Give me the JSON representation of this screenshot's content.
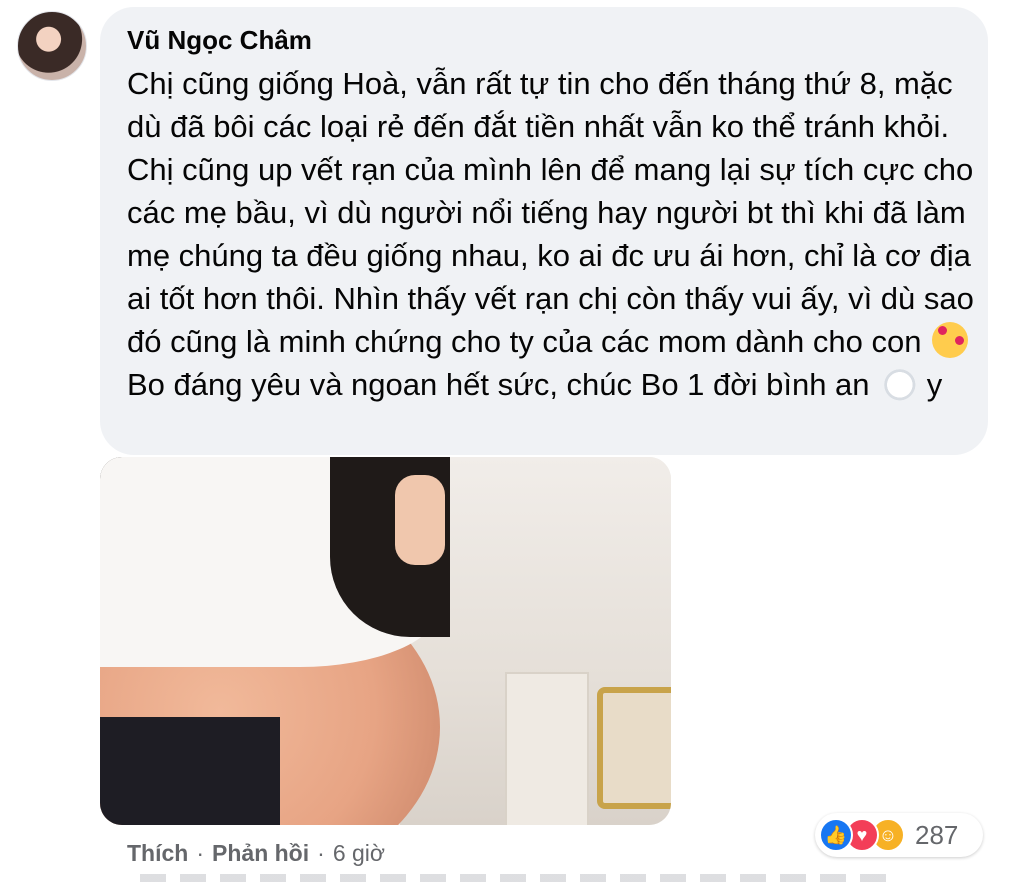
{
  "comment": {
    "author": "Vũ Ngọc Châm",
    "text_part1": "Chị cũng giống Hoà, vẫn rất tự tin cho đến tháng thứ 8, mặc dù đã bôi các loại rẻ đến đắt tiền nhất vẫn ko thể tránh khỏi. Chị cũng up vết rạn của mình lên để mang lại sự tích cực cho các mẹ bầu, vì dù người nổi tiếng hay người bt thì khi đã làm mẹ chúng ta đều giống nhau, ko ai đc ưu ái hơn, chỉ là cơ địa ai tốt hơn thôi. Nhìn thấy vết rạn chị còn thấy vui ấy, vì dù sao đó cũng là minh chứng cho ty của các mom dành cho con",
    "emoji1": "smiling-face-with-hearts",
    "text_part2": "Bo đáng yêu và ngoan hết sức, chúc Bo 1 đời bình an",
    "emoji2": "dove",
    "text_part3": "y"
  },
  "actions": {
    "like": "Thích",
    "reply": "Phản hồi",
    "separator": "·",
    "time": "6 giờ"
  },
  "reactions": {
    "icons": [
      "like-icon",
      "love-icon",
      "care-icon"
    ],
    "count": "287"
  },
  "colors": {
    "bubble": "#f0f2f5",
    "secondary_text": "#65676b",
    "like_blue": "#1877f2",
    "love_red": "#f33e58"
  }
}
